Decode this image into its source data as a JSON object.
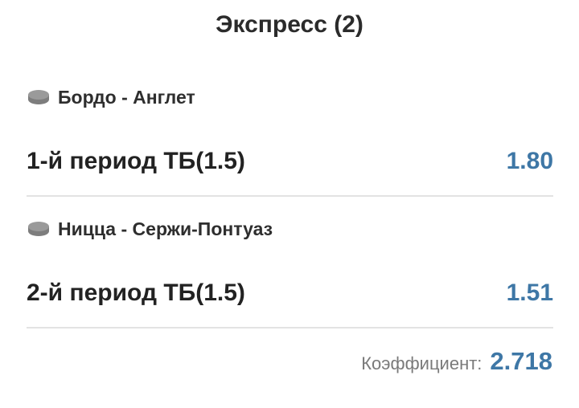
{
  "header": {
    "title": "Экспресс (2)"
  },
  "bets": [
    {
      "match": "Бордо - Англет",
      "market": "1-й период ТБ(1.5)",
      "odd": "1.80",
      "sport_icon": "hockey-puck-icon"
    },
    {
      "match": "Ницца - Сержи-Понтуаз",
      "market": "2-й период ТБ(1.5)",
      "odd": "1.51",
      "sport_icon": "hockey-puck-icon"
    }
  ],
  "summary": {
    "label": "Коэффициент:",
    "value": "2.718"
  },
  "colors": {
    "accent": "#3e77a6",
    "divider": "#e3e3e3",
    "icon": "#8c8c8c"
  }
}
